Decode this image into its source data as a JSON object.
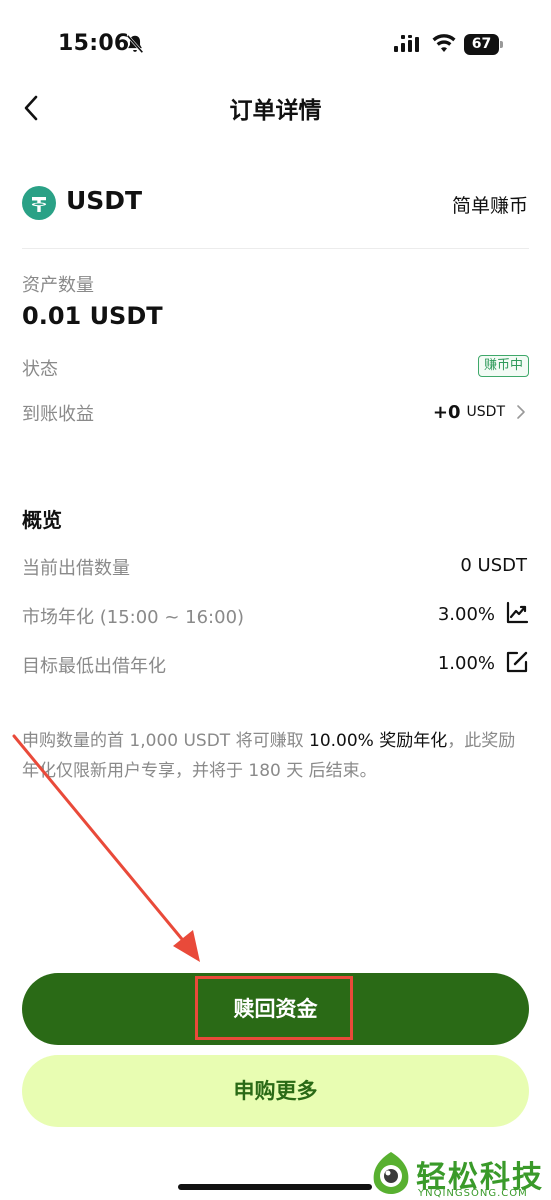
{
  "status_bar": {
    "time": "15:06",
    "battery": "67"
  },
  "nav": {
    "title": "订单详情"
  },
  "asset": {
    "coin": "USDT",
    "product": "简单赚币",
    "amount_label": "资产数量",
    "amount_value": "0.01 USDT",
    "status_label": "状态",
    "status_value": "赚币中",
    "earnings_label": "到账收益",
    "earnings_value": "+0",
    "earnings_unit": "USDT"
  },
  "overview": {
    "title": "概览",
    "rows": [
      {
        "label": "当前出借数量",
        "value": "0 USDT",
        "icon": ""
      },
      {
        "label": "市场年化 (15:00 ~ 16:00)",
        "value": "3.00%",
        "icon": "chart-line-icon"
      },
      {
        "label": "目标最低出借年化",
        "value": "1.00%",
        "icon": "edit-icon"
      }
    ]
  },
  "notice": {
    "part1": "申购数量的首 1,000 USDT 将可赚取 ",
    "highlight": "10.00% 奖励年化",
    "part2": "，此奖励年化仅限新用户专享，并将于 180 天 后结束。"
  },
  "actions": {
    "redeem_label": "赎回资金",
    "subscribe_more_label": "申购更多"
  },
  "colors": {
    "primary_green": "#2a6a16",
    "light_green": "#e8fdb2",
    "annotation_red": "#e94a3a"
  },
  "watermark": {
    "title": "轻松科技",
    "subtitle": "YNQINGSONG.COM"
  }
}
